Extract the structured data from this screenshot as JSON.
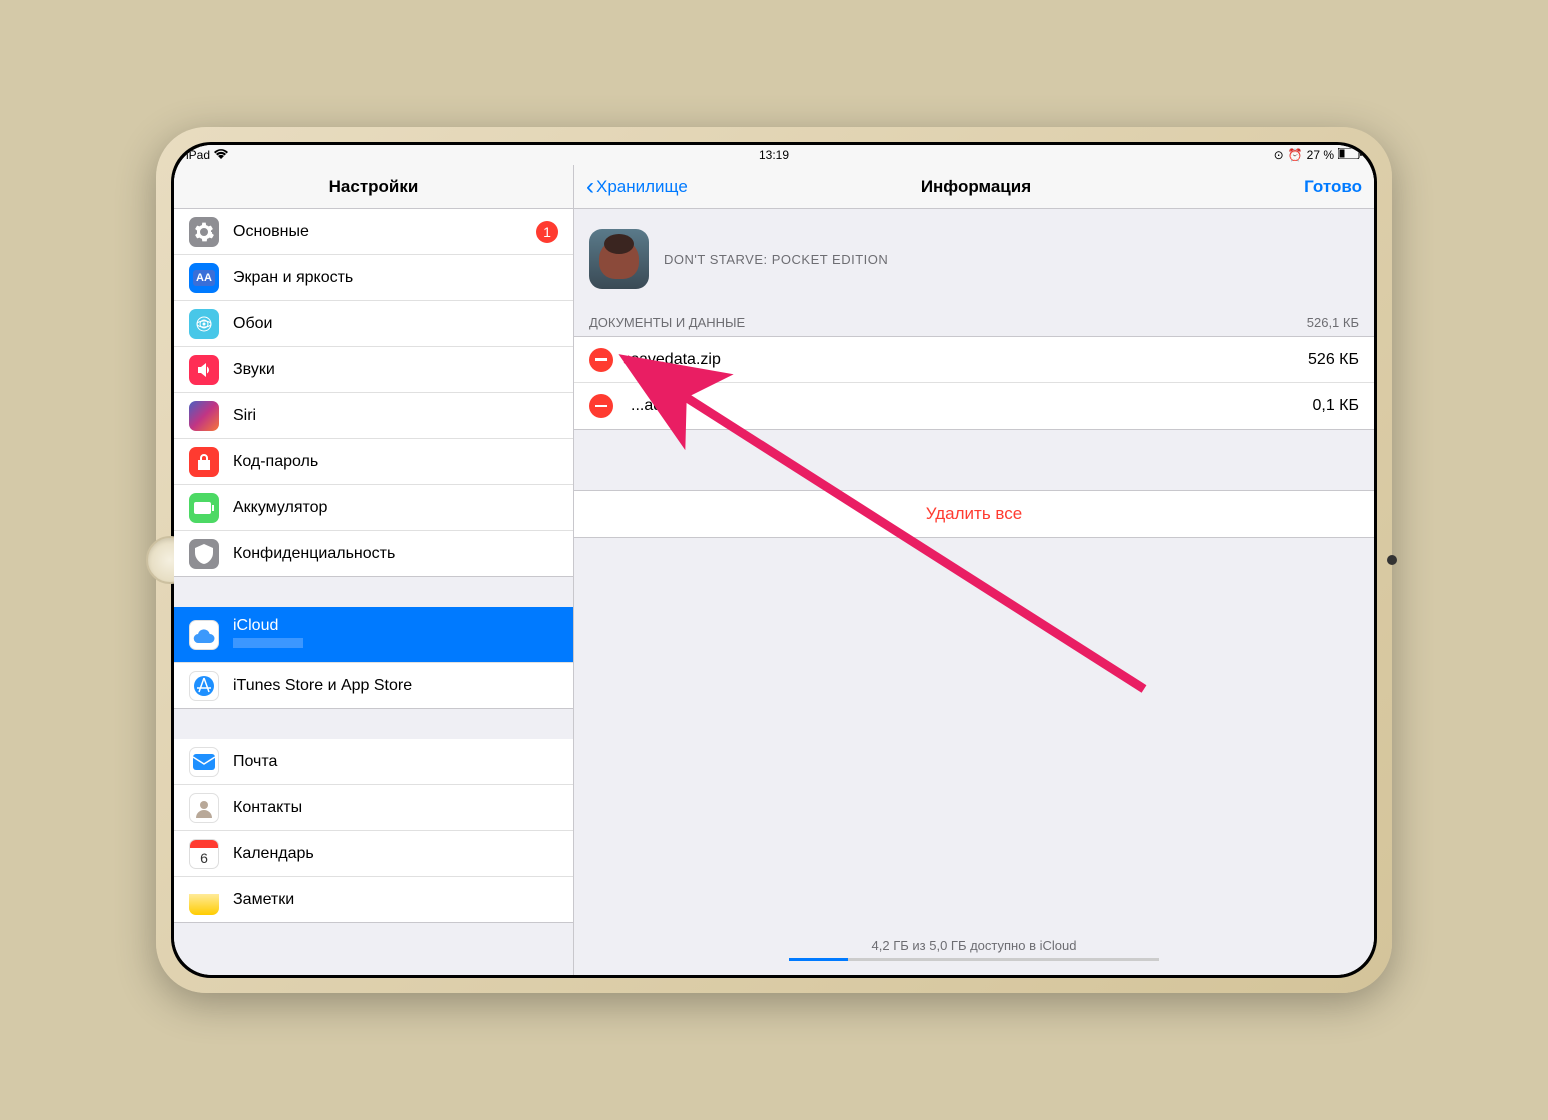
{
  "statusBar": {
    "device": "iPad",
    "time": "13:19",
    "battery": "27 %"
  },
  "sidebar": {
    "title": "Настройки",
    "groups": [
      {
        "items": [
          {
            "label": "Основные",
            "icon": "gear",
            "iconBg": "#8e8e93",
            "badge": "1"
          },
          {
            "label": "Экран и яркость",
            "icon": "display",
            "iconBg": "#007aff"
          },
          {
            "label": "Обои",
            "icon": "wallpaper",
            "iconBg": "#48c7e8"
          },
          {
            "label": "Звуки",
            "icon": "sound",
            "iconBg": "#ff2d55"
          },
          {
            "label": "Siri",
            "icon": "siri",
            "iconBg": "#000"
          },
          {
            "label": "Код-пароль",
            "icon": "lock",
            "iconBg": "#ff3b30"
          },
          {
            "label": "Аккумулятор",
            "icon": "battery",
            "iconBg": "#4cd964"
          },
          {
            "label": "Конфиденциальность",
            "icon": "privacy",
            "iconBg": "#8e8e93"
          }
        ]
      },
      {
        "items": [
          {
            "label": "iCloud",
            "icon": "cloud",
            "iconBg": "#fff",
            "selected": true
          },
          {
            "label": "iTunes Store и App Store",
            "icon": "appstore",
            "iconBg": "#1e90ff"
          }
        ]
      },
      {
        "items": [
          {
            "label": "Почта",
            "icon": "mail",
            "iconBg": "#1e90ff"
          },
          {
            "label": "Контакты",
            "icon": "contacts",
            "iconBg": "#8e8e93"
          },
          {
            "label": "Календарь",
            "icon": "calendar",
            "iconBg": "#fff"
          },
          {
            "label": "Заметки",
            "icon": "notes",
            "iconBg": "#ffcc00"
          }
        ]
      }
    ]
  },
  "main": {
    "backLabel": "Хранилище",
    "title": "Информация",
    "doneLabel": "Готово",
    "appName": "DON'T STARVE: POCKET EDITION",
    "sectionHeader": "ДОКУМЕНТЫ И ДАННЫЕ",
    "sectionTotal": "526,1 КБ",
    "files": [
      {
        "name": "savedata.zip",
        "size": "526 КБ"
      },
      {
        "name": "...ader",
        "size": "0,1 КБ"
      }
    ],
    "deleteAll": "Удалить все",
    "storageText": "4,2 ГБ из 5,0 ГБ доступно в iCloud"
  }
}
